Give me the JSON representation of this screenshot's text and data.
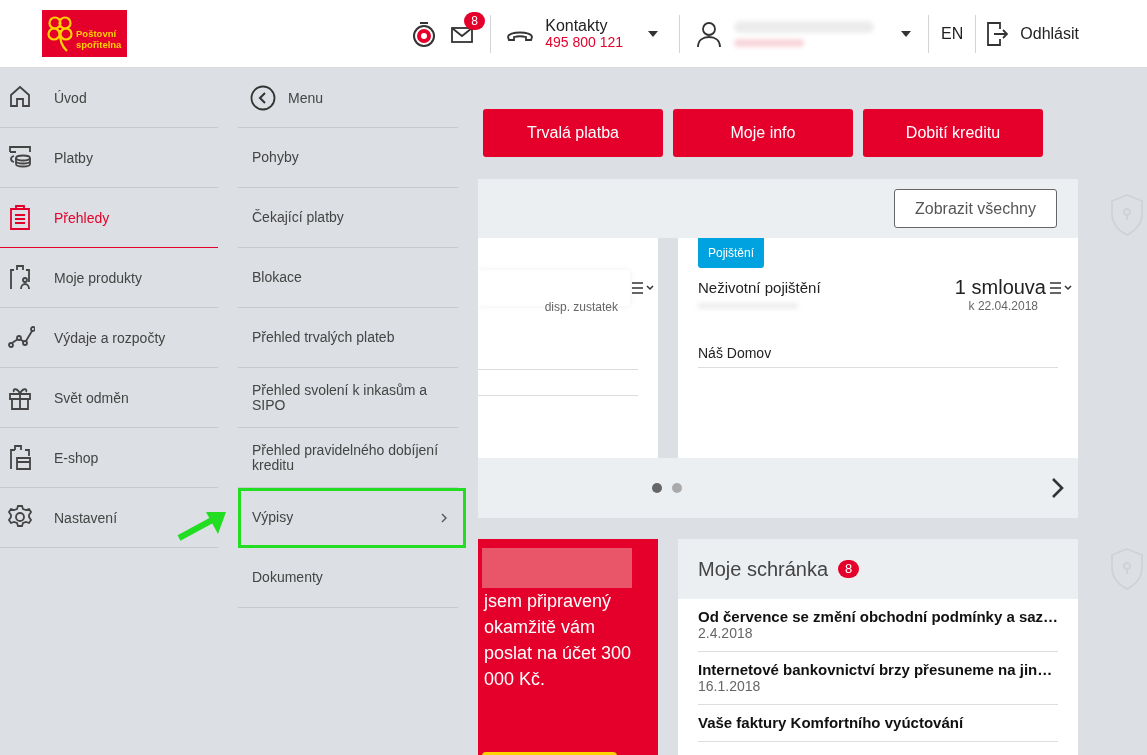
{
  "header": {
    "logo_lines": [
      "Poštovní",
      "spořitelna"
    ],
    "notifications_badge": "8",
    "contacts": {
      "label": "Kontakty",
      "phone": "495 800 121"
    },
    "language": "EN",
    "logout": "Odhlásit"
  },
  "primary_nav": [
    {
      "label": "Úvod",
      "selected": false
    },
    {
      "label": "Platby",
      "selected": false
    },
    {
      "label": "Přehledy",
      "selected": true
    },
    {
      "label": "Moje produkty",
      "selected": false
    },
    {
      "label": "Výdaje a rozpočty",
      "selected": false
    },
    {
      "label": "Svět odměn",
      "selected": false
    },
    {
      "label": "E-shop",
      "selected": false
    },
    {
      "label": "Nastavení",
      "selected": false
    }
  ],
  "secondary_nav": {
    "back_label": "Menu",
    "items": [
      {
        "label": "Pohyby",
        "has_submenu": false,
        "highlighted": false
      },
      {
        "label": "Čekající platby",
        "has_submenu": false,
        "highlighted": false
      },
      {
        "label": "Blokace",
        "has_submenu": false,
        "highlighted": false
      },
      {
        "label": "Přehled trvalých plateb",
        "has_submenu": false,
        "highlighted": false
      },
      {
        "label": "Přehled svolení k inkasům a SIPO",
        "has_submenu": false,
        "highlighted": false
      },
      {
        "label": "Přehled pravidelného dobíjení kreditu",
        "has_submenu": false,
        "highlighted": false
      },
      {
        "label": "Výpisy",
        "has_submenu": true,
        "highlighted": true
      },
      {
        "label": "Dokumenty",
        "has_submenu": false,
        "highlighted": false
      }
    ]
  },
  "quick_actions": [
    "Trvalá platba",
    "Moje info",
    "Dobití kreditu"
  ],
  "products": {
    "show_all": "Zobrazit všechny",
    "account_card": {
      "balance_caption": "disp. zustatek"
    },
    "insurance_card": {
      "tag": "Pojištění",
      "title": "Neživotní pojištění",
      "count": "1 smlouva",
      "date": "k 22.04.2018",
      "item": "Náš Domov"
    },
    "dots": [
      {
        "selected": true
      },
      {
        "selected": false
      }
    ]
  },
  "promo": {
    "text": "jsem připravený okamžitě vám poslat na účet 300 000 Kč."
  },
  "mailbox": {
    "title": "Moje schránka",
    "badge": "8",
    "messages": [
      {
        "subject": "Od července se změní obchodní podmínky a saz…",
        "date": "2.4.2018"
      },
      {
        "subject": "Internetové bankovnictví brzy přesuneme na jin…",
        "date": "16.1.2018"
      },
      {
        "subject": "Vaše faktury Komfortního vyúctování"
      }
    ]
  }
}
